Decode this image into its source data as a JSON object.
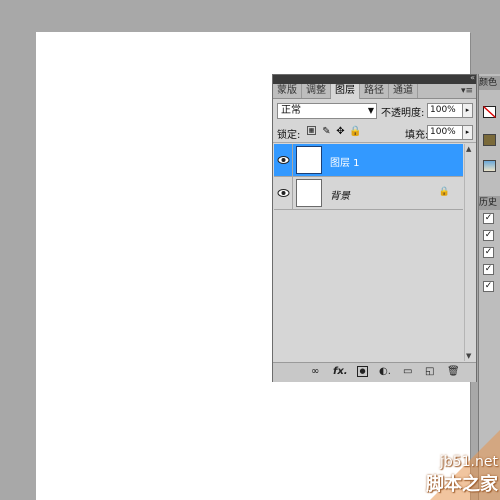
{
  "panel": {
    "collapse_icon": "«",
    "tabs": [
      "蒙版",
      "调整",
      "图层",
      "路径",
      "通道"
    ],
    "active_tab": "图层",
    "menu_icon": "▾≡",
    "blend_mode": "正常",
    "opacity_label": "不透明度:",
    "opacity_value": "100%",
    "lock_label": "锁定:",
    "fill_label": "填充:",
    "fill_value": "100%",
    "layers": [
      {
        "name": "图层 1",
        "selected": true,
        "locked": false
      },
      {
        "name": "背景",
        "selected": false,
        "locked": true
      }
    ],
    "bottom_icons": [
      "link-icon",
      "fx-icon",
      "mask-icon",
      "adjustment-icon",
      "group-icon",
      "new-layer-icon",
      "trash-icon"
    ],
    "bottom_fx_label": "fx."
  },
  "right_strip": {
    "tab1": "颜色",
    "tab2": "历史"
  },
  "watermark": {
    "line1": "jb51.net",
    "line2": "脚本之家"
  },
  "colors": {
    "selection": "#3399ff",
    "workspace": "#a8a8a8",
    "panel": "#d6d6d6"
  }
}
